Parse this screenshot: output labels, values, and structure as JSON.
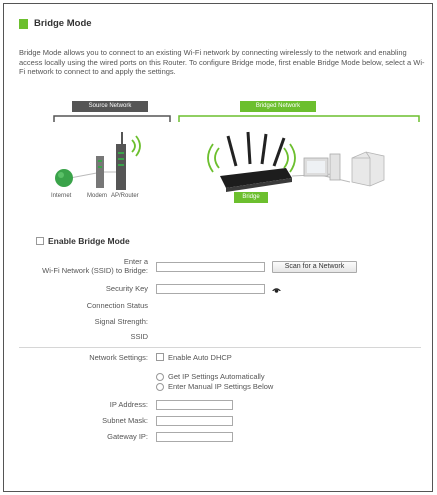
{
  "header": {
    "title": "Bridge Mode"
  },
  "description": "Bridge Mode allows you to connect to an existing Wi-Fi network by connecting wirelessly to the network and enabling access locally using the wired ports on this Router. To configure Bridge mode, first enable Bridge Mode below, select a Wi-Fi network to connect to and apply the settings.",
  "diagram": {
    "source_label": "Source Network",
    "bridged_label": "Bridged Network",
    "bridge_label": "Bridge",
    "captions": {
      "internet": "Internet",
      "modem": "Modem",
      "router": "AP/Router"
    },
    "colors": {
      "accent": "#6cbf2e",
      "dark": "#555555",
      "globe": "#3aa34a"
    }
  },
  "form": {
    "enable_bridge_label": "Enable Bridge Mode",
    "ssid_label_line1": "Enter a",
    "ssid_label_line2": "Wi-Fi Network (SSID) to Bridge:",
    "ssid_value": "",
    "scan_button": "Scan for a Network",
    "security_key_label": "Security Key",
    "security_key_value": "",
    "connection_status_label": "Connection Status",
    "signal_strength_label": "Signal Strength:",
    "ssid_info_label": "SSID",
    "network_settings_label": "Network Settings:",
    "auto_dhcp_label": "Enable Auto DHCP",
    "auto_ip_label": "Get IP Settings Automatically",
    "manual_ip_label": "Enter Manual IP Settings Below",
    "ip_address_label": "IP Address:",
    "subnet_mask_label": "Subnet Mask:",
    "gateway_ip_label": "Gateway IP:"
  }
}
